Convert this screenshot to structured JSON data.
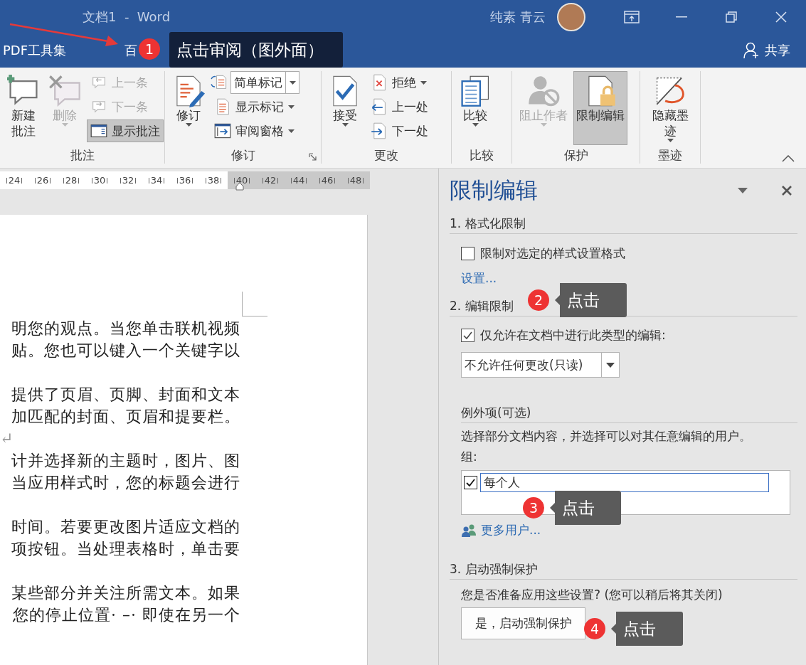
{
  "window": {
    "title": "文档1  -  Word",
    "user": "纯素 青云"
  },
  "tabs": [
    {
      "label": "PDF工具集"
    },
    {
      "label": "百"
    }
  ],
  "share": "共享",
  "ribbon": {
    "groups": [
      {
        "label": "批注",
        "launcher": false,
        "items": [
          {
            "kind": "large",
            "label": "新建批注",
            "disabled": false,
            "pressed": false,
            "dropdown": false
          },
          {
            "kind": "large",
            "label": "删除",
            "disabled": true,
            "pressed": false,
            "dropdown": true
          },
          {
            "kind": "small",
            "label": "上一条",
            "disabled": true,
            "pressed": false,
            "dropdown": false
          },
          {
            "kind": "small",
            "label": "下一条",
            "disabled": true,
            "pressed": false,
            "dropdown": false
          },
          {
            "kind": "small",
            "label": "显示批注",
            "disabled": false,
            "pressed": true,
            "dropdown": false
          }
        ]
      },
      {
        "label": "修订",
        "launcher": true,
        "items": [
          {
            "kind": "large",
            "label": "修订",
            "disabled": false,
            "pressed": false,
            "dropdown": true
          },
          {
            "kind": "combo",
            "label": "简单标记",
            "dropdown": true
          },
          {
            "kind": "small",
            "label": "显示标记",
            "disabled": false,
            "pressed": false,
            "dropdown": true
          },
          {
            "kind": "small",
            "label": "审阅窗格",
            "disabled": false,
            "pressed": false,
            "dropdown": true
          }
        ]
      },
      {
        "label": "更改",
        "launcher": false,
        "items": [
          {
            "kind": "large",
            "label": "接受",
            "disabled": false,
            "pressed": false,
            "dropdown": true
          },
          {
            "kind": "small",
            "label": "拒绝",
            "disabled": false,
            "pressed": false,
            "dropdown": true
          },
          {
            "kind": "small",
            "label": "上一处",
            "disabled": false,
            "pressed": false,
            "dropdown": false
          },
          {
            "kind": "small",
            "label": "下一处",
            "disabled": false,
            "pressed": false,
            "dropdown": false
          }
        ]
      },
      {
        "label": "比较",
        "launcher": false,
        "items": [
          {
            "kind": "large",
            "label": "比较",
            "disabled": false,
            "pressed": false,
            "dropdown": true
          }
        ]
      },
      {
        "label": "保护",
        "launcher": false,
        "items": [
          {
            "kind": "large",
            "label": "阻止作者",
            "disabled": true,
            "pressed": false,
            "dropdown": true
          },
          {
            "kind": "large",
            "label": "限制编辑",
            "disabled": false,
            "pressed": true,
            "dropdown": false
          }
        ]
      },
      {
        "label": "墨迹",
        "launcher": false,
        "items": [
          {
            "kind": "large",
            "label": "隐藏墨迹",
            "disabled": false,
            "pressed": false,
            "dropdown": true
          }
        ]
      }
    ]
  },
  "ruler": [
    {
      "label": "24",
      "margin": false
    },
    {
      "label": "26",
      "margin": false
    },
    {
      "label": "28",
      "margin": false
    },
    {
      "label": "30",
      "margin": false
    },
    {
      "label": "32",
      "margin": false
    },
    {
      "label": "34",
      "margin": false
    },
    {
      "label": "36",
      "margin": false
    },
    {
      "label": "38",
      "margin": false
    },
    {
      "label": "40",
      "margin": true
    },
    {
      "label": "42",
      "margin": true
    },
    {
      "label": "44",
      "margin": true
    },
    {
      "label": "46",
      "margin": true
    },
    {
      "label": "48",
      "margin": true
    }
  ],
  "document": {
    "paragraphs": [
      {
        "kind": "text",
        "lines": [
          "明您的观点。当您单击联机视频",
          "贴。您也可以键入一个关键字以"
        ]
      },
      {
        "kind": "text",
        "lines": [
          "提供了页眉、页脚、封面和文本",
          "加匹配的封面、页眉和提要栏。"
        ]
      },
      {
        "kind": "empty",
        "lines": [
          "↵"
        ]
      },
      {
        "kind": "text",
        "lines": [
          "计并选择新的主题时，图片、图",
          "当应用样式时，您的标题会进行"
        ]
      },
      {
        "kind": "text",
        "lines": [
          "时间。若要更改图片适应文档的",
          "项按钮。当处理表格时，单击要"
        ]
      },
      {
        "kind": "text",
        "lines": [
          "某些部分并关注所需文本。如果",
          "您的停止位置· –· 即使在另一个"
        ]
      }
    ]
  },
  "pane": {
    "title": "限制编辑",
    "format": {
      "heading": "1. 格式化限制",
      "checkbox": {
        "label": "限制对选定的样式设置格式",
        "checked": false
      },
      "link": "设置..."
    },
    "editing": {
      "heading": "2. 编辑限制",
      "checkbox": {
        "label": "仅允许在文档中进行此类型的编辑:",
        "checked": true
      },
      "select": {
        "value": "不允许任何更改(只读)"
      },
      "exceptions": {
        "heading": "例外项(可选)",
        "description": "选择部分文档内容，并选择可以对其任意编辑的用户。",
        "groups_label": "组:",
        "groups": [
          {
            "name": "每个人",
            "checked": true,
            "selected": true
          }
        ],
        "more_users": "更多用户..."
      }
    },
    "enforce": {
      "heading": "3. 启动强制保护",
      "question": "您是否准备应用这些设置? (您可以稍后将其关闭)",
      "button": "是，启动强制保护"
    }
  },
  "annotations": [
    {
      "kind": "banner",
      "number": "1",
      "text": "点击审阅（图外面）"
    },
    {
      "kind": "callout",
      "number": "2",
      "text": "点击"
    },
    {
      "kind": "callout",
      "number": "3",
      "text": "点击"
    },
    {
      "kind": "callout",
      "number": "4",
      "text": "点击"
    }
  ]
}
